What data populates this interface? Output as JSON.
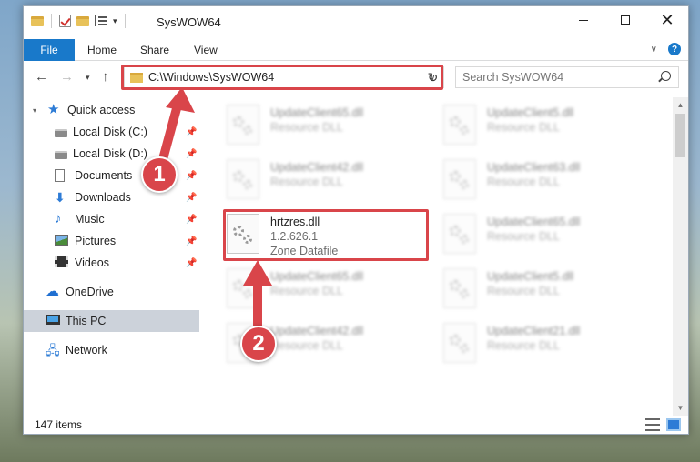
{
  "window": {
    "title": "SysWOW64"
  },
  "ribbon": {
    "file_label": "File",
    "tabs": [
      "Home",
      "Share",
      "View"
    ]
  },
  "navbar": {
    "address": "C:\\Windows\\SysWOW64",
    "search_placeholder": "Search SysWOW64"
  },
  "sidebar": {
    "quick_access": "Quick access",
    "items": [
      {
        "label": "Local Disk (C:)",
        "icon": "drive-icon"
      },
      {
        "label": "Local Disk (D:)",
        "icon": "drive-icon"
      },
      {
        "label": "Documents",
        "icon": "documents-icon"
      },
      {
        "label": "Downloads",
        "icon": "downloads-icon"
      },
      {
        "label": "Music",
        "icon": "music-icon"
      },
      {
        "label": "Pictures",
        "icon": "pictures-icon"
      },
      {
        "label": "Videos",
        "icon": "videos-icon"
      }
    ],
    "onedrive": "OneDrive",
    "this_pc": "This PC",
    "network": "Network"
  },
  "files": {
    "left": [
      {
        "name": "UpdateClient65.dll",
        "desc": "Resource DLL"
      },
      {
        "name": "UpdateClient42.dll",
        "desc": "Resource DLL"
      },
      {
        "name": "hrtzres.dll",
        "version": "1.2.626.1",
        "desc": "Zone Datafile"
      },
      {
        "name": "UpdateClient65.dll",
        "desc": "Resource DLL"
      },
      {
        "name": "UpdateClient42.dll",
        "desc": "Resource DLL"
      }
    ],
    "right": [
      {
        "name": "UpdateClient5.dll",
        "desc": "Resource DLL"
      },
      {
        "name": "UpdateClient63.dll",
        "desc": "Resource DLL"
      },
      {
        "name": "UpdateClient65.dll",
        "desc": "Resource DLL"
      },
      {
        "name": "UpdateClient5.dll",
        "desc": "Resource DLL"
      },
      {
        "name": "UpdateClient21.dll",
        "desc": "Resource DLL"
      }
    ]
  },
  "status": {
    "item_count": "147 items"
  },
  "annotations": {
    "step1": "1",
    "step2": "2",
    "highlight_color": "#d9454a"
  }
}
